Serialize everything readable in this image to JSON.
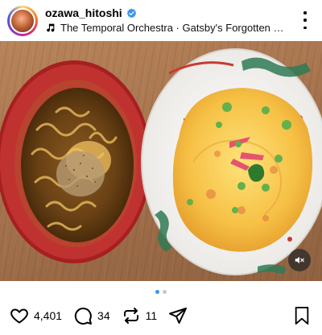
{
  "post": {
    "username": "ozawa_hitoshi",
    "verified": true,
    "music": "The Temporal Orchestra · Gatsby's Forgotten Mel...",
    "icons": {
      "verified": "verified-badge-icon",
      "music": "music-note-icon",
      "more": "more-options-icon",
      "mute": "muted-speaker-icon"
    },
    "carousel": {
      "count": 2,
      "active": 1
    },
    "stats": {
      "likes": "4,401",
      "comments": "34",
      "reposts": "11"
    },
    "colors": {
      "verified_blue": "#3897f0",
      "bowl_red": "#c0322f",
      "omelette_yellow": "#f2c14e",
      "table_wood": "#a87650"
    }
  }
}
